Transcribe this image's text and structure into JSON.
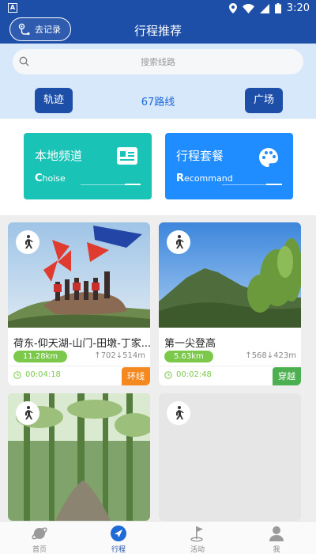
{
  "status_bar": {
    "time": "3:20",
    "left_glyph": "A"
  },
  "header": {
    "record_label": "去记录",
    "title": "行程推荐"
  },
  "search": {
    "placeholder": "搜索线路"
  },
  "filters": {
    "track_label": "轨迹",
    "route_count": "67路线",
    "square_label": "广场"
  },
  "categories": [
    {
      "title": "本地频道",
      "sub_first": "C",
      "sub_rest": "hoise",
      "color": "#19c3b5",
      "icon": "id-card-icon"
    },
    {
      "title": "行程套餐",
      "sub_first": "R",
      "sub_rest": "ecommand",
      "color": "#1f8cff",
      "icon": "palette-icon"
    }
  ],
  "routes": [
    {
      "name": "荷东-仰天湖-山门-田墩-丁家...",
      "distance": "11.28km",
      "ascent": "702",
      "descent": "514m",
      "duration": "00:04:18",
      "badge": "环线",
      "badge_color": "#f5891f"
    },
    {
      "name": "第一尖登高",
      "distance": "5.63km",
      "ascent": "568",
      "descent": "423m",
      "duration": "00:02:48",
      "badge": "穿越",
      "badge_color": "#4caf50"
    },
    {
      "name": "",
      "distance": "",
      "ascent": "",
      "descent": "",
      "duration": "",
      "badge": "",
      "badge_color": ""
    },
    {
      "name": "",
      "distance": "",
      "ascent": "",
      "descent": "",
      "duration": "",
      "badge": "",
      "badge_color": ""
    }
  ],
  "tabs": [
    {
      "label": "首页",
      "icon": "planet-icon",
      "active": false
    },
    {
      "label": "行程",
      "icon": "navigation-icon",
      "active": true
    },
    {
      "label": "活动",
      "icon": "flag-icon",
      "active": false
    },
    {
      "label": "我",
      "icon": "user-icon",
      "active": false
    }
  ]
}
